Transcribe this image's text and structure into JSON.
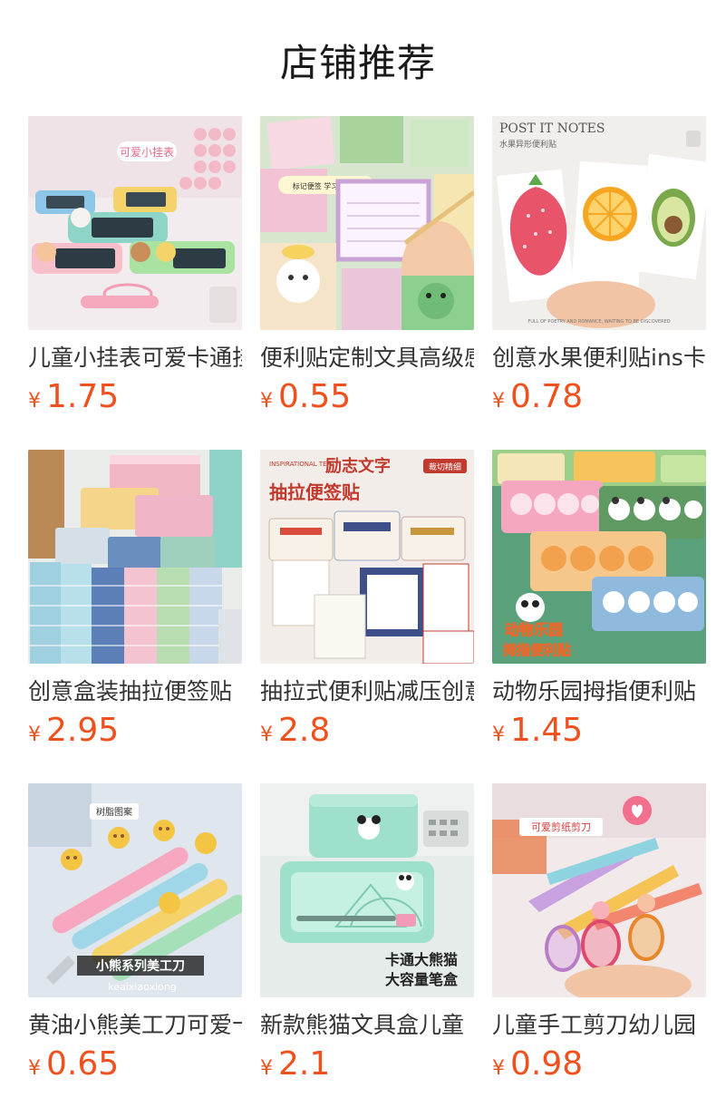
{
  "header": {
    "title": "店铺推荐"
  },
  "products": [
    {
      "title": "儿童小挂表可爱卡通挂件",
      "currency": "¥",
      "price": "1.75",
      "image": {
        "icon": "clock-keychain",
        "texts": [
          "可爱小挂表"
        ],
        "bg": "#f3ecef",
        "accent": "#8fd0c8"
      }
    },
    {
      "title": "便利贴定制文具高级感",
      "currency": "¥",
      "price": "0.55",
      "image": {
        "icon": "sticky-notes",
        "texts": [
          "标记便签 学习好帮手"
        ],
        "bg": "#d9e6cf",
        "accent": "#c9a3d6"
      }
    },
    {
      "title": "创意水果便利贴ins卡通",
      "currency": "¥",
      "price": "0.78",
      "image": {
        "icon": "fruit-notes",
        "texts": [
          "POST IT NOTES",
          "水果异形便利贴",
          "FULL OF POETRY AND ROMANCE, WAITING TO BE DISCOVERED"
        ],
        "bg": "#f1efec",
        "accent": "#e8556b"
      }
    },
    {
      "title": "创意盒装抽拉便签贴",
      "currency": "¥",
      "price": "2.95",
      "image": {
        "icon": "box-notes",
        "texts": [],
        "bg": "#e9ece8",
        "accent": "#f2b7c4"
      }
    },
    {
      "title": "抽拉式便利贴减压创意",
      "currency": "¥",
      "price": "2.8",
      "image": {
        "icon": "pullout-notes",
        "texts": [
          "INSPIRATIONAL TEXT",
          "励志文字",
          "抽拉便签贴",
          "裁切精细"
        ],
        "bg": "#f2ede8",
        "accent": "#c23a2e"
      }
    },
    {
      "title": "动物乐园拇指便利贴",
      "currency": "¥",
      "price": "1.45",
      "image": {
        "icon": "animal-notes",
        "texts": [
          "动物乐园",
          "拇指便利贴"
        ],
        "bg": "#5aa07b",
        "accent": "#f2a24c"
      }
    },
    {
      "title": "黄油小熊美工刀可爱卡通",
      "currency": "¥",
      "price": "0.65",
      "image": {
        "icon": "bear-cutters",
        "texts": [
          "树脂图案",
          "小熊系列美工刀",
          "keaixiaoxiong"
        ],
        "bg": "#dfe6ee",
        "accent": "#f4c542"
      }
    },
    {
      "title": "新款熊猫文具盒儿童",
      "currency": "¥",
      "price": "2.1",
      "image": {
        "icon": "panda-pencil-case",
        "texts": [
          "卡通大熊猫",
          "大容量笔盒"
        ],
        "bg": "#e6ece9",
        "accent": "#9fe0cc"
      }
    },
    {
      "title": "儿童手工剪刀幼儿园",
      "currency": "¥",
      "price": "0.98",
      "image": {
        "icon": "kids-scissors",
        "texts": [
          "可爱剪纸剪刀"
        ],
        "bg": "#f1e9ea",
        "accent": "#f26f8d"
      }
    }
  ]
}
